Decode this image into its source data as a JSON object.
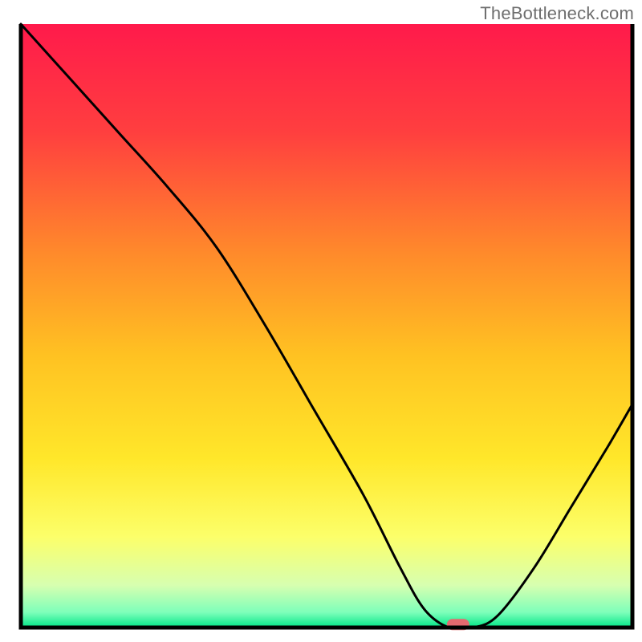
{
  "watermark": "TheBottleneck.com",
  "chart_data": {
    "type": "line",
    "title": "",
    "xlabel": "",
    "ylabel": "",
    "xlim": [
      0,
      100
    ],
    "ylim": [
      0,
      100
    ],
    "x": [
      0,
      8,
      16,
      24,
      32,
      40,
      48,
      56,
      62,
      66,
      70,
      74,
      78,
      84,
      90,
      96,
      100
    ],
    "values": [
      100,
      91,
      82,
      73,
      63,
      50,
      36,
      22,
      10,
      3,
      0,
      0,
      2,
      10,
      20,
      30,
      37
    ],
    "marker": {
      "x": 71.5,
      "y": 0.5
    },
    "background_gradient_stops": [
      {
        "offset": 0.0,
        "color": "#ff1a4b"
      },
      {
        "offset": 0.18,
        "color": "#ff3f3f"
      },
      {
        "offset": 0.38,
        "color": "#ff8a2b"
      },
      {
        "offset": 0.55,
        "color": "#ffc222"
      },
      {
        "offset": 0.72,
        "color": "#ffe72a"
      },
      {
        "offset": 0.85,
        "color": "#fcff6a"
      },
      {
        "offset": 0.93,
        "color": "#d7ffb0"
      },
      {
        "offset": 0.975,
        "color": "#7dffba"
      },
      {
        "offset": 1.0,
        "color": "#00e587"
      }
    ],
    "marker_color": "#e46a6f",
    "line_color": "#000000",
    "frame_color": "#000000"
  }
}
